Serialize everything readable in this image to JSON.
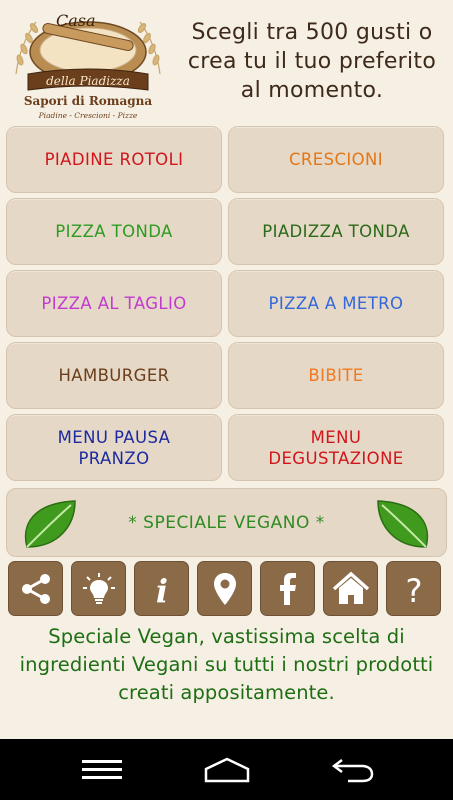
{
  "logo": {
    "line1": "Casa",
    "line2": "della Piadizza",
    "line3": "Sapori di Romagna",
    "line4": "Piadine - Crescioni - Pizze"
  },
  "tagline": "Scegli tra 500 gusti o crea tu il tuo preferito al momento.",
  "menu": [
    {
      "label": "PIADINE ROTOLI",
      "color": "#d0161c"
    },
    {
      "label": "CRESCIONI",
      "color": "#e0781a"
    },
    {
      "label": "PIZZA TONDA",
      "color": "#2e9b22"
    },
    {
      "label": "PIADIZZA TONDA",
      "color": "#2a6a18"
    },
    {
      "label": "PIZZA AL TAGLIO",
      "color": "#c23ad0"
    },
    {
      "label": "PIZZA A METRO",
      "color": "#3467d8"
    },
    {
      "label": "HAMBURGER",
      "color": "#6b3e1c"
    },
    {
      "label": "BIBITE",
      "color": "#f07a22"
    },
    {
      "label": "MENU PAUSA PRANZO",
      "color": "#1c2aa0"
    },
    {
      "label": "MENU DEGUSTAZIONE",
      "color": "#d0161c"
    }
  ],
  "vegan_button": {
    "label": "* SPECIALE VEGANO *",
    "color": "#2e8b22"
  },
  "toolbar": {
    "icons": [
      "share-icon",
      "lightbulb-icon",
      "info-icon",
      "location-pin-icon",
      "facebook-icon",
      "home-icon",
      "help-icon"
    ],
    "colors": {
      "bg": "#8b6a48",
      "icon": "#ffffff"
    }
  },
  "info_text": "Speciale Vegan, vastissima scelta di ingredienti Vegani su tutti i nostri prodotti creati appositamente.",
  "colors": {
    "background": "#f6efe3",
    "button_bg": "#e6d8c6",
    "info_text": "#1e6e14"
  }
}
